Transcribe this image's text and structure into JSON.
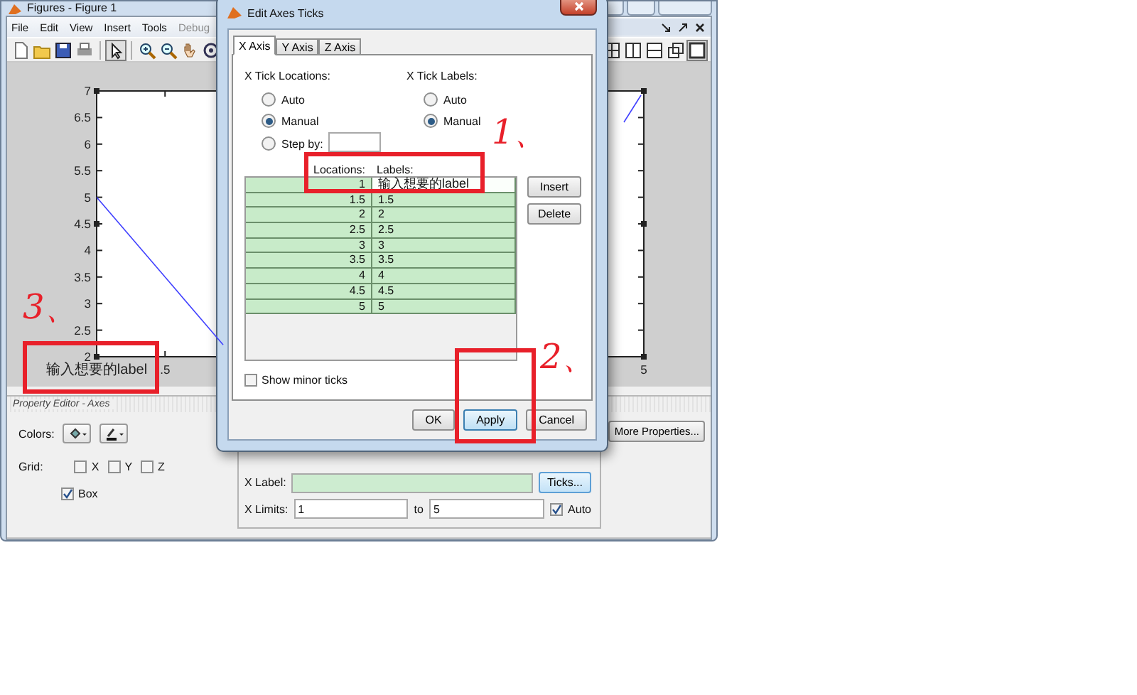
{
  "figure_window": {
    "title": "Figures - Figure 1",
    "menu": [
      {
        "label": "File",
        "disabled": false
      },
      {
        "label": "Edit",
        "disabled": false
      },
      {
        "label": "View",
        "disabled": false
      },
      {
        "label": "Insert",
        "disabled": false
      },
      {
        "label": "Tools",
        "disabled": false
      },
      {
        "label": "Debug",
        "disabled": true
      }
    ],
    "plot": {
      "chart_data": {
        "type": "line",
        "categories": [
          "输入想要的label",
          ".5",
          null,
          null,
          null,
          null,
          null,
          null,
          "5"
        ],
        "series": [
          {
            "color": "#4040ff",
            "values": [
              5,
              3.5,
              null,
              null,
              null,
              null,
              null,
              null,
              null
            ]
          }
        ],
        "ylim": [
          2,
          7
        ],
        "yticks": [
          2,
          2.5,
          3,
          3.5,
          4,
          4.5,
          5,
          5.5,
          6,
          6.5,
          7
        ]
      }
    },
    "property_editor": {
      "title": "Property Editor - Axes",
      "colors_label": "Colors:",
      "grid_label": "Grid:",
      "grid": [
        {
          "label": "X",
          "checked": false
        },
        {
          "label": "Y",
          "checked": false
        },
        {
          "label": "Z",
          "checked": false
        }
      ],
      "box": {
        "label": "Box",
        "checked": true
      },
      "more_properties": "More Properties...",
      "x_label": "X Label:",
      "ticks_button": "Ticks...",
      "x_limits": {
        "label": "X Limits:",
        "from": "1",
        "to_label": "to",
        "to": "5",
        "auto": {
          "label": "Auto",
          "checked": true
        }
      }
    }
  },
  "dialog": {
    "title": "Edit Axes Ticks",
    "tabs": [
      {
        "label": "X Axis",
        "selected": true
      },
      {
        "label": "Y Axis",
        "selected": false
      },
      {
        "label": "Z Axis",
        "selected": false
      }
    ],
    "locations": {
      "heading": "X Tick Locations:",
      "options": [
        {
          "label": "Auto",
          "selected": false
        },
        {
          "label": "Manual",
          "selected": true
        },
        {
          "label": "Step by:",
          "selected": false
        }
      ]
    },
    "labels": {
      "heading": "X Tick Labels:",
      "options": [
        {
          "label": "Auto",
          "selected": false
        },
        {
          "label": "Manual",
          "selected": true
        }
      ]
    },
    "table": {
      "columns": [
        "Locations:",
        "Labels:"
      ],
      "rows": [
        {
          "location": "1",
          "label": "输入想要的label",
          "editing": true
        },
        {
          "location": "1.5",
          "label": "1.5",
          "editing": false
        },
        {
          "location": "2",
          "label": "2",
          "editing": false
        },
        {
          "location": "2.5",
          "label": "2.5",
          "editing": false
        },
        {
          "location": "3",
          "label": "3",
          "editing": false
        },
        {
          "location": "3.5",
          "label": "3.5",
          "editing": false
        },
        {
          "location": "4",
          "label": "4",
          "editing": false
        },
        {
          "location": "4.5",
          "label": "4.5",
          "editing": false
        },
        {
          "location": "5",
          "label": "5",
          "editing": false
        }
      ]
    },
    "side_buttons": [
      "Insert",
      "Delete"
    ],
    "minor_ticks": {
      "label": "Show minor ticks",
      "checked": false
    },
    "buttons": [
      {
        "label": "OK",
        "default": false
      },
      {
        "label": "Apply",
        "default": true
      },
      {
        "label": "Cancel",
        "default": false
      }
    ]
  },
  "annotations": [
    {
      "mark": "1、"
    },
    {
      "mark": "2、"
    },
    {
      "mark": "3、"
    }
  ]
}
